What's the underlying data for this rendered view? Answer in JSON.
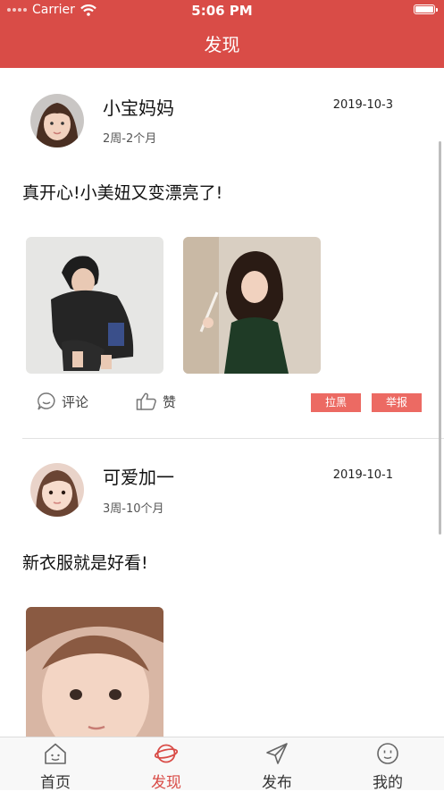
{
  "status_bar": {
    "carrier": "Carrier",
    "time": "5:06 PM"
  },
  "navbar": {
    "title": "发现"
  },
  "posts": [
    {
      "username": "小宝妈妈",
      "baby_age": "2周-2个月",
      "date": "2019-10-3",
      "text": "真开心!小美妞又变漂亮了!",
      "comment_label": "评论",
      "like_label": "赞",
      "block_label": "拉黑",
      "report_label": "举报"
    },
    {
      "username": "可爱加一",
      "baby_age": "3周-10个月",
      "date": "2019-10-1",
      "text": "新衣服就是好看!"
    }
  ],
  "tabbar": {
    "items": [
      {
        "label": "首页",
        "icon": "home-icon"
      },
      {
        "label": "发现",
        "icon": "planet-icon"
      },
      {
        "label": "发布",
        "icon": "paper-plane-icon"
      },
      {
        "label": "我的",
        "icon": "smiley-face-icon"
      }
    ],
    "active_index": 1
  },
  "colors": {
    "brand_red": "#d94c47",
    "tag_red": "#ec6a63"
  }
}
